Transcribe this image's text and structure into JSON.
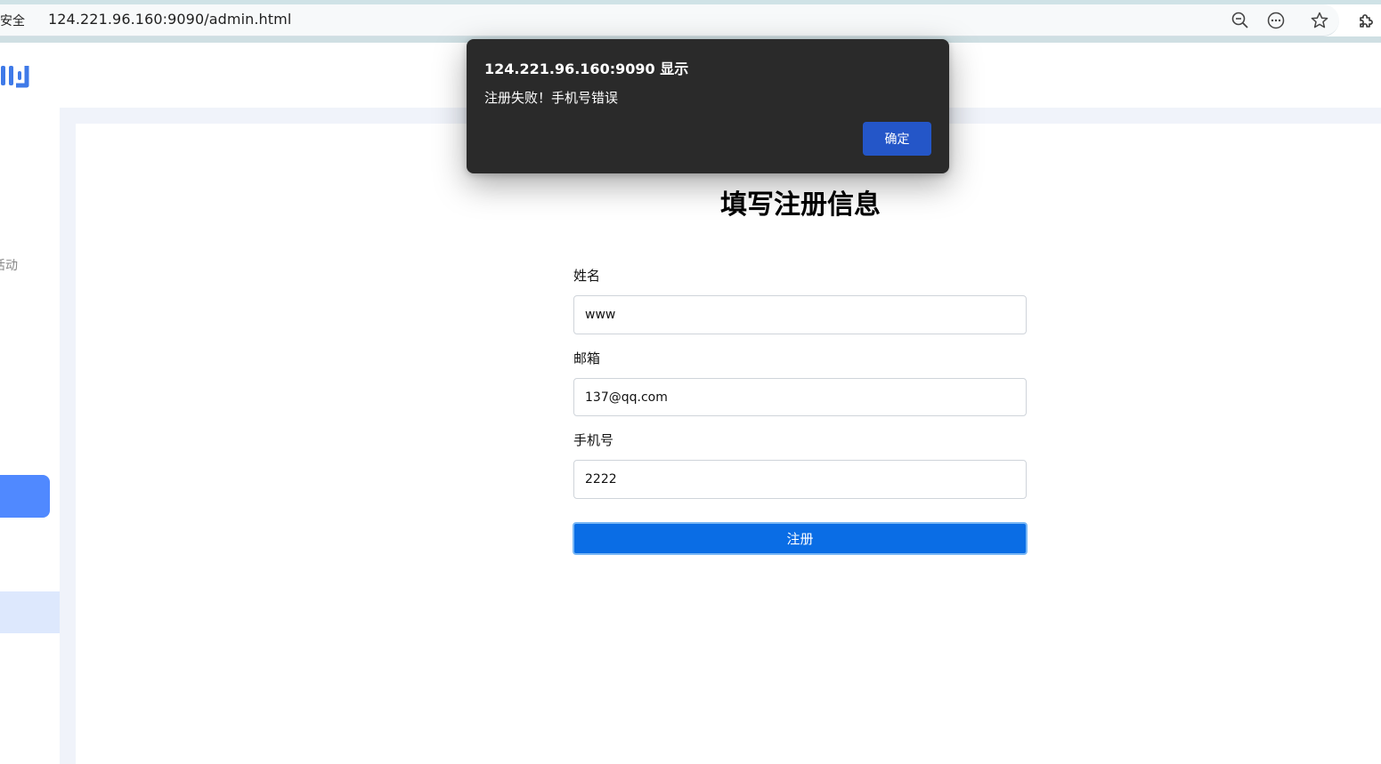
{
  "browser": {
    "security_label": "不安全",
    "url": "124.221.96.160:9090/admin.html",
    "icons": [
      "zoom-out-icon",
      "more-options-icon",
      "favorite-star-icon",
      "extensions-icon"
    ]
  },
  "sidebar": {
    "partial_item_label": "活动"
  },
  "form": {
    "title": "填写注册信息",
    "fields": [
      {
        "label": "姓名",
        "value": "www"
      },
      {
        "label": "邮箱",
        "value": "137@qq.com"
      },
      {
        "label": "手机号",
        "value": "2222"
      }
    ],
    "submit_label": "注册"
  },
  "alert": {
    "title": "124.221.96.160:9090 显示",
    "message": "注册失败！手机号错误",
    "ok_label": "确定"
  },
  "colors": {
    "primary_button": "#0a6de5",
    "alert_bg": "#2a2a2a",
    "alert_button": "#2456c8",
    "sidebar_active": "#5089ff",
    "sidebar_selected": "#dde8fd",
    "content_frame": "#f0f3fa"
  }
}
